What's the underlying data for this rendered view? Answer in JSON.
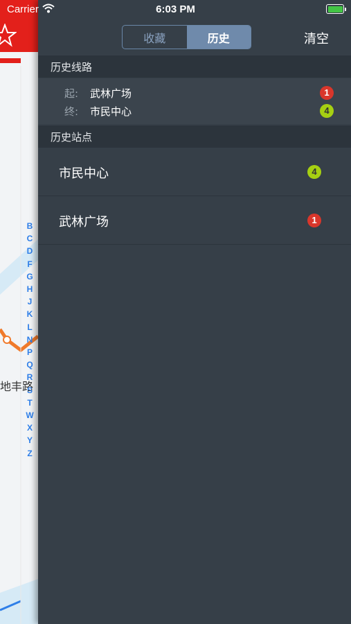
{
  "status_bar": {
    "carrier": "Carrier",
    "time": "6:03 PM"
  },
  "background": {
    "map_text": "地丰路",
    "index_letters": [
      "B",
      "C",
      "D",
      "F",
      "G",
      "H",
      "J",
      "K",
      "L",
      "N",
      "P",
      "Q",
      "R",
      "S",
      "T",
      "W",
      "X",
      "Y",
      "Z"
    ]
  },
  "nav": {
    "tabs": [
      {
        "label": "收藏",
        "active": false
      },
      {
        "label": "历史",
        "active": true
      }
    ],
    "clear_label": "清空"
  },
  "history_routes": {
    "header": "历史线路",
    "start_key": "起:",
    "start_station": "武林广场",
    "start_line": "1",
    "end_key": "终:",
    "end_station": "市民中心",
    "end_line": "4"
  },
  "history_stations": {
    "header": "历史站点",
    "items": [
      {
        "name": "市民中心",
        "line": "4"
      },
      {
        "name": "武林广场",
        "line": "1"
      }
    ]
  },
  "colors": {
    "line1": "#d9362b",
    "line4": "#a6d012",
    "accent": "#6f8aab",
    "panel": "#363f48"
  }
}
